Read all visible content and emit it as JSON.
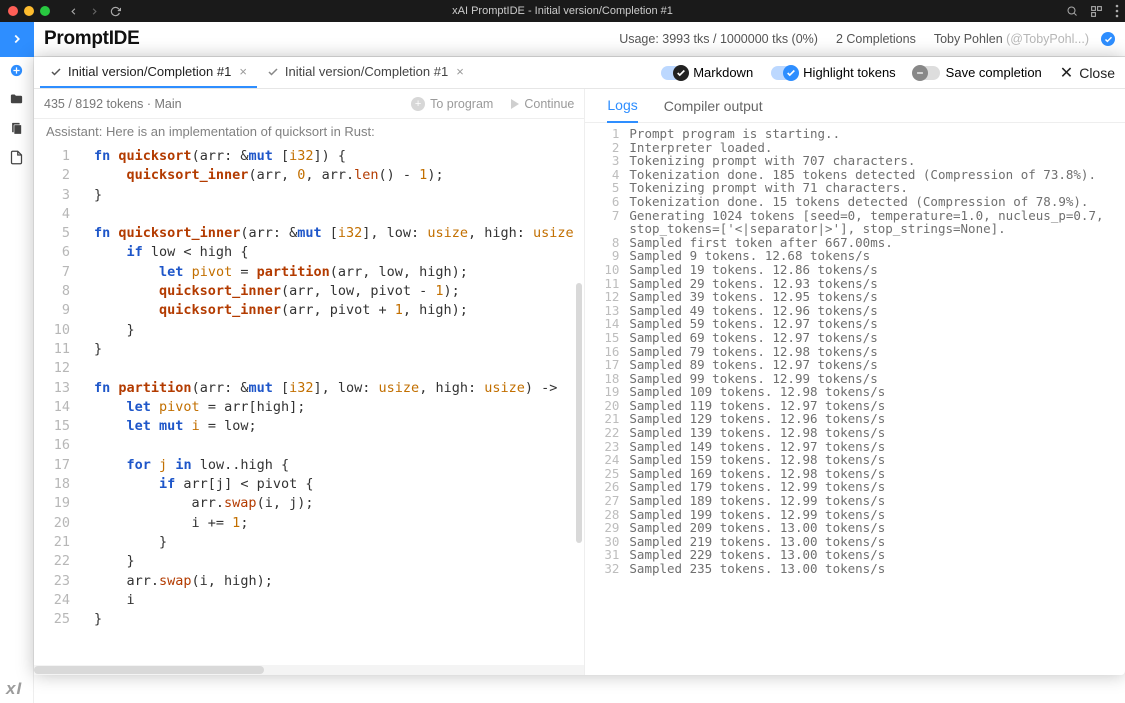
{
  "window": {
    "title": "xAI PromptIDE - Initial version/Completion #1"
  },
  "app": {
    "title": "PromptIDE",
    "usage": "Usage: 3993 tks / 1000000 tks (0%)",
    "completions": "2 Completions",
    "user_name": "Toby Pohlen",
    "user_handle": "(@TobyPohl...)"
  },
  "tabs": [
    {
      "label": "Initial version/Completion #1"
    },
    {
      "label": "Initial version/Completion #1"
    }
  ],
  "toggles": {
    "markdown": "Markdown",
    "highlight": "Highlight tokens",
    "save": "Save completion",
    "close": "Close"
  },
  "subbar": {
    "tokens": "435 / 8192 tokens · Main",
    "to_program": "To program",
    "continue": "Continue"
  },
  "assistant_line": "Assistant: Here is an implementation of quicksort in Rust:",
  "right_tabs": {
    "logs": "Logs",
    "compiler": "Compiler output"
  },
  "code_lines": [
    {
      "n": 1,
      "t": "<span class='kw'>fn</span> <span class='fn'>quicksort</span>(arr: &<span class='kw'>mut</span> [<span class='ty'>i32</span>]) {"
    },
    {
      "n": 2,
      "t": "    <span class='fn'>quicksort_inner</span>(arr, <span class='num'>0</span>, arr.<span class='mt'>len</span>() - <span class='num'>1</span>);"
    },
    {
      "n": 3,
      "t": "}"
    },
    {
      "n": 4,
      "t": ""
    },
    {
      "n": 5,
      "t": "<span class='kw'>fn</span> <span class='fn'>quicksort_inner</span>(arr: &<span class='kw'>mut</span> [<span class='ty'>i32</span>], low: <span class='ty'>usize</span>, high: <span class='ty'>usize</span>"
    },
    {
      "n": 6,
      "t": "    <span class='kw'>if</span> low &lt; high {"
    },
    {
      "n": 7,
      "t": "        <span class='kw'>let</span> <span class='var'>pivot</span> = <span class='fn'>partition</span>(arr, low, high);"
    },
    {
      "n": 8,
      "t": "        <span class='fn'>quicksort_inner</span>(arr, low, pivot - <span class='num'>1</span>);"
    },
    {
      "n": 9,
      "t": "        <span class='fn'>quicksort_inner</span>(arr, pivot + <span class='num'>1</span>, high);"
    },
    {
      "n": 10,
      "t": "    }"
    },
    {
      "n": 11,
      "t": "}"
    },
    {
      "n": 12,
      "t": ""
    },
    {
      "n": 13,
      "t": "<span class='kw'>fn</span> <span class='fn'>partition</span>(arr: &<span class='kw'>mut</span> [<span class='ty'>i32</span>], low: <span class='ty'>usize</span>, high: <span class='ty'>usize</span>) -&gt; "
    },
    {
      "n": 14,
      "t": "    <span class='kw'>let</span> <span class='var'>pivot</span> = arr[high];"
    },
    {
      "n": 15,
      "t": "    <span class='kw'>let</span> <span class='kw'>mut</span> <span class='var'>i</span> = low;"
    },
    {
      "n": 16,
      "t": ""
    },
    {
      "n": 17,
      "t": "    <span class='kw'>for</span> <span class='var'>j</span> <span class='kw'>in</span> low..high {"
    },
    {
      "n": 18,
      "t": "        <span class='kw'>if</span> arr[j] &lt; pivot {"
    },
    {
      "n": 19,
      "t": "            arr.<span class='mt'>swap</span>(i, j);"
    },
    {
      "n": 20,
      "t": "            i += <span class='num'>1</span>;"
    },
    {
      "n": 21,
      "t": "        }"
    },
    {
      "n": 22,
      "t": "    }"
    },
    {
      "n": 23,
      "t": "    arr.<span class='mt'>swap</span>(i, high);"
    },
    {
      "n": 24,
      "t": "    i"
    },
    {
      "n": 25,
      "t": "}"
    }
  ],
  "log_lines": [
    {
      "n": 1,
      "t": "Prompt program is starting.."
    },
    {
      "n": 2,
      "t": "Interpreter loaded."
    },
    {
      "n": 3,
      "t": "Tokenizing prompt with 707 characters."
    },
    {
      "n": 4,
      "t": "Tokenization done. 185 tokens detected (Compression of 73.8%)."
    },
    {
      "n": 5,
      "t": "Tokenizing prompt with 71 characters."
    },
    {
      "n": 6,
      "t": "Tokenization done. 15 tokens detected (Compression of 78.9%)."
    },
    {
      "n": 7,
      "t": "Generating 1024 tokens [seed=0, temperature=1.0, nucleus_p=0.7, stop_tokens=['<|separator|>'], stop_strings=None]."
    },
    {
      "n": 8,
      "t": "Sampled first token after 667.00ms."
    },
    {
      "n": 9,
      "t": "Sampled 9 tokens. 12.68 tokens/s"
    },
    {
      "n": 10,
      "t": "Sampled 19 tokens. 12.86 tokens/s"
    },
    {
      "n": 11,
      "t": "Sampled 29 tokens. 12.93 tokens/s"
    },
    {
      "n": 12,
      "t": "Sampled 39 tokens. 12.95 tokens/s"
    },
    {
      "n": 13,
      "t": "Sampled 49 tokens. 12.96 tokens/s"
    },
    {
      "n": 14,
      "t": "Sampled 59 tokens. 12.97 tokens/s"
    },
    {
      "n": 15,
      "t": "Sampled 69 tokens. 12.97 tokens/s"
    },
    {
      "n": 16,
      "t": "Sampled 79 tokens. 12.98 tokens/s"
    },
    {
      "n": 17,
      "t": "Sampled 89 tokens. 12.97 tokens/s"
    },
    {
      "n": 18,
      "t": "Sampled 99 tokens. 12.99 tokens/s"
    },
    {
      "n": 19,
      "t": "Sampled 109 tokens. 12.98 tokens/s"
    },
    {
      "n": 20,
      "t": "Sampled 119 tokens. 12.97 tokens/s"
    },
    {
      "n": 21,
      "t": "Sampled 129 tokens. 12.96 tokens/s"
    },
    {
      "n": 22,
      "t": "Sampled 139 tokens. 12.98 tokens/s"
    },
    {
      "n": 23,
      "t": "Sampled 149 tokens. 12.97 tokens/s"
    },
    {
      "n": 24,
      "t": "Sampled 159 tokens. 12.98 tokens/s"
    },
    {
      "n": 25,
      "t": "Sampled 169 tokens. 12.98 tokens/s"
    },
    {
      "n": 26,
      "t": "Sampled 179 tokens. 12.99 tokens/s"
    },
    {
      "n": 27,
      "t": "Sampled 189 tokens. 12.99 tokens/s"
    },
    {
      "n": 28,
      "t": "Sampled 199 tokens. 12.99 tokens/s"
    },
    {
      "n": 29,
      "t": "Sampled 209 tokens. 13.00 tokens/s"
    },
    {
      "n": 30,
      "t": "Sampled 219 tokens. 13.00 tokens/s"
    },
    {
      "n": 31,
      "t": "Sampled 229 tokens. 13.00 tokens/s"
    },
    {
      "n": 32,
      "t": "Sampled 235 tokens. 13.00 tokens/s"
    }
  ],
  "footer": "xI"
}
